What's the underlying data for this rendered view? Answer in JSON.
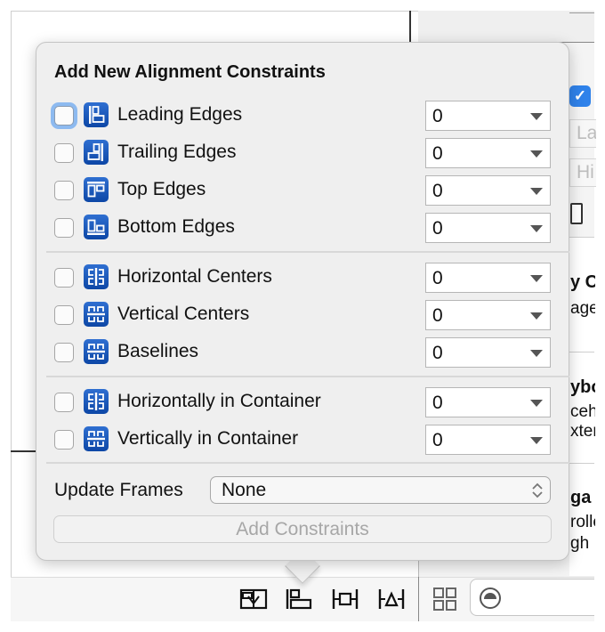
{
  "popover": {
    "title": "Add New Alignment Constraints",
    "groups": [
      [
        {
          "label": "Leading Edges",
          "checked": false,
          "focused": true,
          "icon": "leading-edges-icon",
          "value": "0"
        },
        {
          "label": "Trailing Edges",
          "checked": false,
          "focused": false,
          "icon": "trailing-edges-icon",
          "value": "0"
        },
        {
          "label": "Top Edges",
          "checked": false,
          "focused": false,
          "icon": "top-edges-icon",
          "value": "0"
        },
        {
          "label": "Bottom Edges",
          "checked": false,
          "focused": false,
          "icon": "bottom-edges-icon",
          "value": "0"
        }
      ],
      [
        {
          "label": "Horizontal Centers",
          "checked": false,
          "focused": false,
          "icon": "horizontal-centers-icon",
          "value": "0"
        },
        {
          "label": "Vertical Centers",
          "checked": false,
          "focused": false,
          "icon": "vertical-centers-icon",
          "value": "0"
        },
        {
          "label": "Baselines",
          "checked": false,
          "focused": false,
          "icon": "baselines-icon",
          "value": "0"
        }
      ],
      [
        {
          "label": "Horizontally in Container",
          "checked": false,
          "focused": false,
          "icon": "horizontally-in-container-icon",
          "value": "0"
        },
        {
          "label": "Vertically in Container",
          "checked": false,
          "focused": false,
          "icon": "vertically-in-container-icon",
          "value": "0"
        }
      ]
    ],
    "update_frames": {
      "label": "Update Frames",
      "value": "None"
    },
    "add_button": {
      "label": "Add Constraints",
      "enabled": false
    }
  },
  "inspector": {
    "checkbox_checked": true,
    "field_label_1": "La",
    "field_label_2": "Hi",
    "text_1": "y C",
    "text_2": "age",
    "text_3": "ybo",
    "text_4": "ceh",
    "text_5": "xter",
    "text_6": "ga",
    "text_7": "rolle",
    "text_8": "gh"
  },
  "toolbar": {
    "icons": [
      "embed-in-stack-icon",
      "align-icon",
      "pin-icon",
      "resolve-auto-layout-icon",
      "object-library-grid-icon",
      "filter-icon"
    ]
  },
  "colors": {
    "accent": "#2f82ea",
    "icon_blue": "#0d47a6",
    "focus_ring": "#8dbaf0",
    "disabled_text": "#a7a7a7"
  }
}
